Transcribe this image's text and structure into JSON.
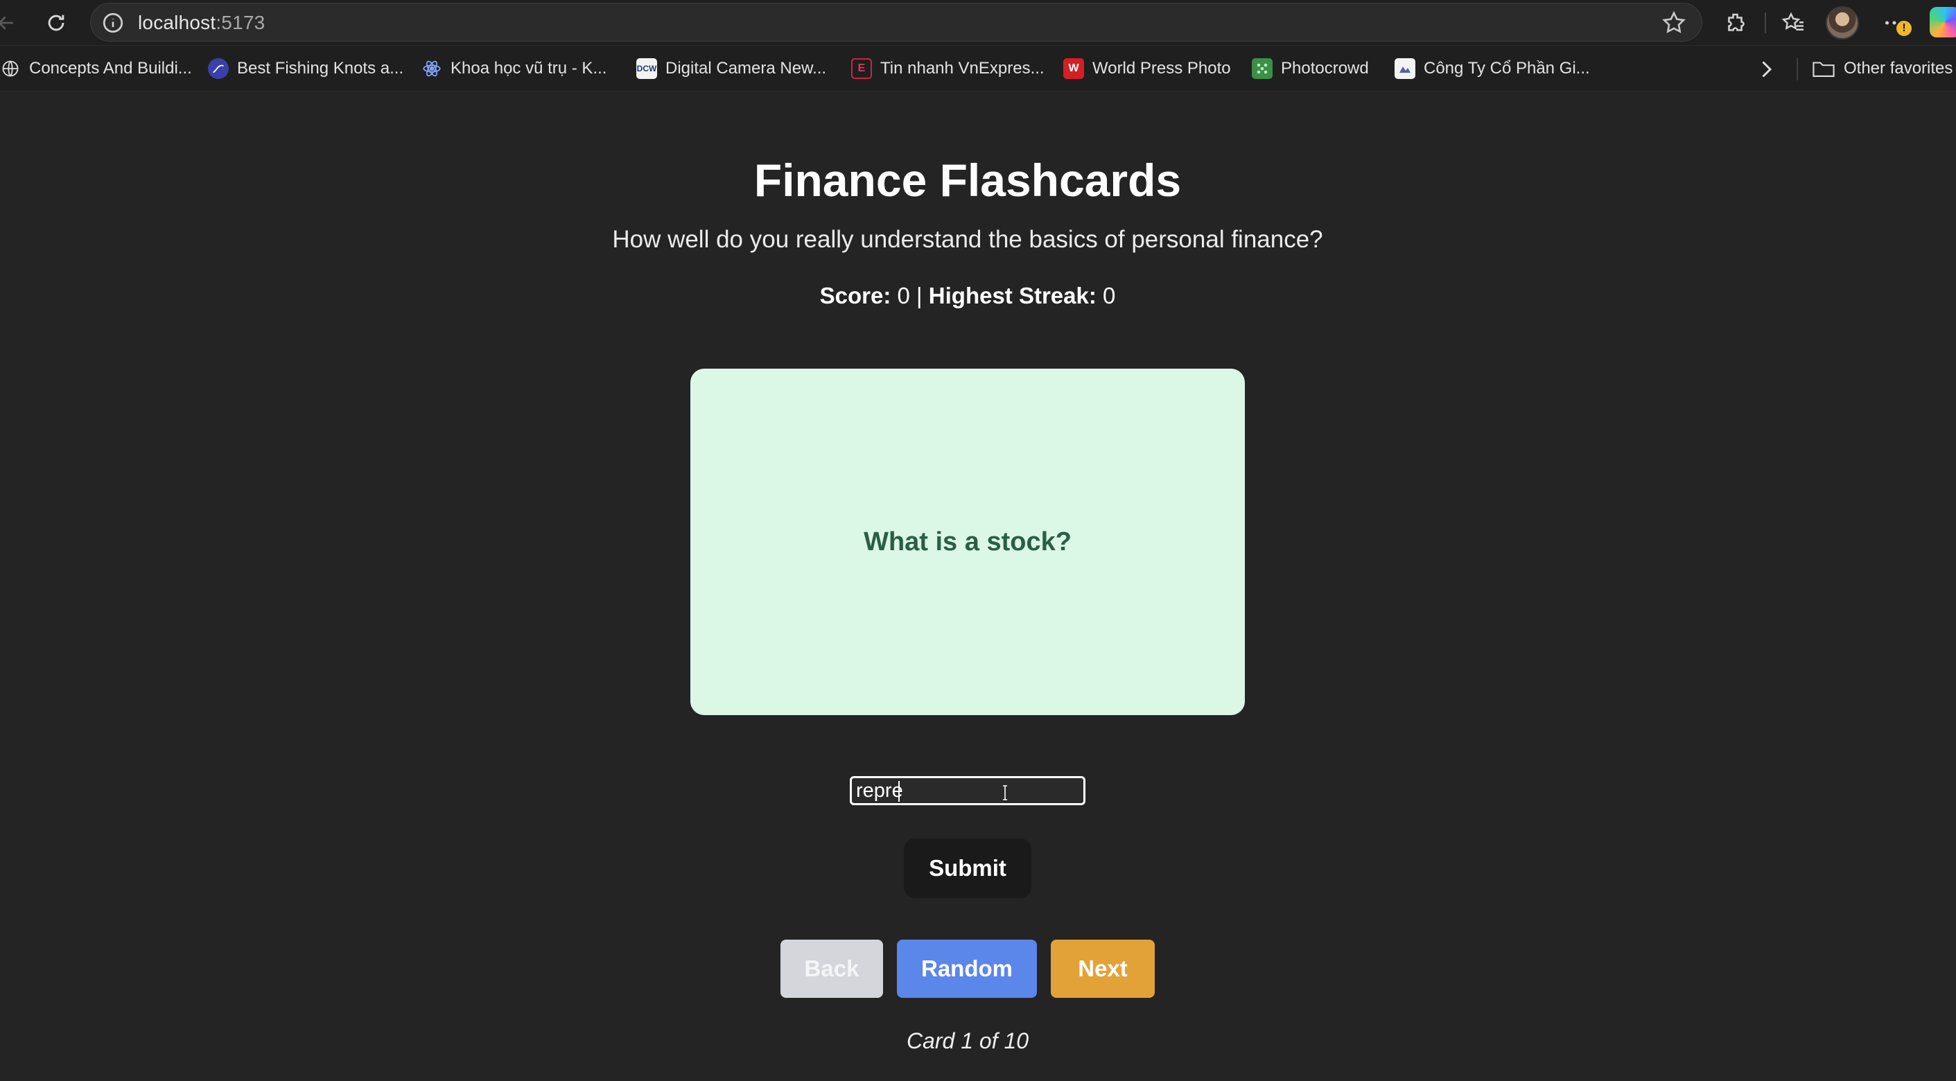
{
  "browser": {
    "url_host": "localhost",
    "url_port": ":5173",
    "bookmarks": [
      {
        "label": "Concepts And Buildi...",
        "icon": "globe-icon"
      },
      {
        "label": "Best Fishing Knots a...",
        "icon": "fishing-knot-icon"
      },
      {
        "label": "Khoa học vũ trụ - K...",
        "icon": "atom-icon"
      },
      {
        "label": "Digital Camera New...",
        "icon": "dcw-icon",
        "icon_text": "DCW"
      },
      {
        "label": "Tin nhanh VnExpres...",
        "icon": "vnexpress-icon",
        "icon_text": "E"
      },
      {
        "label": "World Press Photo",
        "icon": "wpp-icon",
        "icon_text": "W"
      },
      {
        "label": "Photocrowd",
        "icon": "photocrowd-icon"
      },
      {
        "label": "Công Ty Cổ Phần Gi...",
        "icon": "company-icon"
      }
    ],
    "other_favorites": "Other favorites",
    "alert_badge": "!"
  },
  "page": {
    "title": "Finance Flashcards",
    "subtitle": "How well do you really understand the basics of personal finance?",
    "score_label": "Score:",
    "score_value": "0",
    "separator": "|",
    "streak_label": "Highest Streak:",
    "streak_value": "0",
    "card_text": "What is a stock?",
    "answer_value": "repre",
    "submit_label": "Submit",
    "back_label": "Back",
    "random_label": "Random",
    "next_label": "Next",
    "card_counter": "Card 1 of 10"
  },
  "colors": {
    "background": "#242424",
    "card_bg": "#dbf7e6",
    "card_text": "#2a5e45",
    "back_btn": "#d4d6db",
    "random_btn": "#5b86ea",
    "next_btn": "#e3a237",
    "submit_btn": "#1a1a1a"
  }
}
